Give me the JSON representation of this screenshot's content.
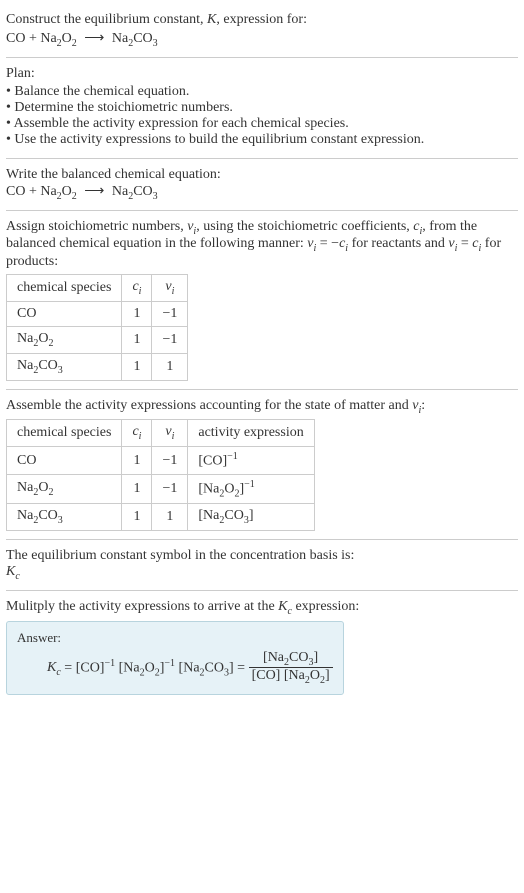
{
  "prompt": {
    "line1": "Construct the equilibrium constant, <span class='ital'>K</span>, expression for:",
    "equation": "CO + Na<span class='sub'>2</span>O<span class='sub'>2</span> <span class='arrow'>⟶</span> Na<span class='sub'>2</span>CO<span class='sub'>3</span>"
  },
  "plan": {
    "title": "Plan:",
    "items": [
      "• Balance the chemical equation.",
      "• Determine the stoichiometric numbers.",
      "• Assemble the activity expression for each chemical species.",
      "• Use the activity expressions to build the equilibrium constant expression."
    ]
  },
  "balanced": {
    "title": "Write the balanced chemical equation:",
    "equation": "CO + Na<span class='sub'>2</span>O<span class='sub'>2</span> <span class='arrow'>⟶</span> Na<span class='sub'>2</span>CO<span class='sub'>3</span>"
  },
  "stoich": {
    "intro": "Assign stoichiometric numbers, <span class='ital'>ν<span class='sub'>i</span></span>, using the stoichiometric coefficients, <span class='ital'>c<span class='sub'>i</span></span>, from the balanced chemical equation in the following manner: <span class='ital'>ν<span class='sub'>i</span></span> = −<span class='ital'>c<span class='sub'>i</span></span> for reactants and <span class='ital'>ν<span class='sub'>i</span></span> = <span class='ital'>c<span class='sub'>i</span></span> for products:",
    "headers": [
      "chemical species",
      "<span class='ital'>c<span class='sub'>i</span></span>",
      "<span class='ital'>ν<span class='sub'>i</span></span>"
    ],
    "rows": [
      [
        "CO",
        "1",
        "−1"
      ],
      [
        "Na<span class='sub'>2</span>O<span class='sub'>2</span>",
        "1",
        "−1"
      ],
      [
        "Na<span class='sub'>2</span>CO<span class='sub'>3</span>",
        "1",
        "1"
      ]
    ]
  },
  "activity": {
    "intro": "Assemble the activity expressions accounting for the state of matter and <span class='ital'>ν<span class='sub'>i</span></span>:",
    "headers": [
      "chemical species",
      "<span class='ital'>c<span class='sub'>i</span></span>",
      "<span class='ital'>ν<span class='sub'>i</span></span>",
      "activity expression"
    ],
    "rows": [
      [
        "CO",
        "1",
        "−1",
        "[CO]<span class='sup'>−1</span>"
      ],
      [
        "Na<span class='sub'>2</span>O<span class='sub'>2</span>",
        "1",
        "−1",
        "[Na<span class='sub'>2</span>O<span class='sub'>2</span>]<span class='sup'>−1</span>"
      ],
      [
        "Na<span class='sub'>2</span>CO<span class='sub'>3</span>",
        "1",
        "1",
        "[Na<span class='sub'>2</span>CO<span class='sub'>3</span>]"
      ]
    ]
  },
  "symbol": {
    "line1": "The equilibrium constant symbol in the concentration basis is:",
    "line2": "<span class='ital'>K<span class='sub'>c</span></span>"
  },
  "multiply": {
    "line": "Mulitply the activity expressions to arrive at the <span class='ital'>K<span class='sub'>c</span></span> expression:"
  },
  "answer": {
    "label": "Answer:",
    "expr": "<span class='ital'>K<span class='sub'>c</span></span> = [CO]<span class='sup'>−1</span> [Na<span class='sub'>2</span>O<span class='sub'>2</span>]<span class='sup'>−1</span> [Na<span class='sub'>2</span>CO<span class='sub'>3</span>] = <span class='frac'><span class='num'>[Na<span class='sub'>2</span>CO<span class='sub'>3</span>]</span><span class='den'>[CO] [Na<span class='sub'>2</span>O<span class='sub'>2</span>]</span></span>"
  }
}
